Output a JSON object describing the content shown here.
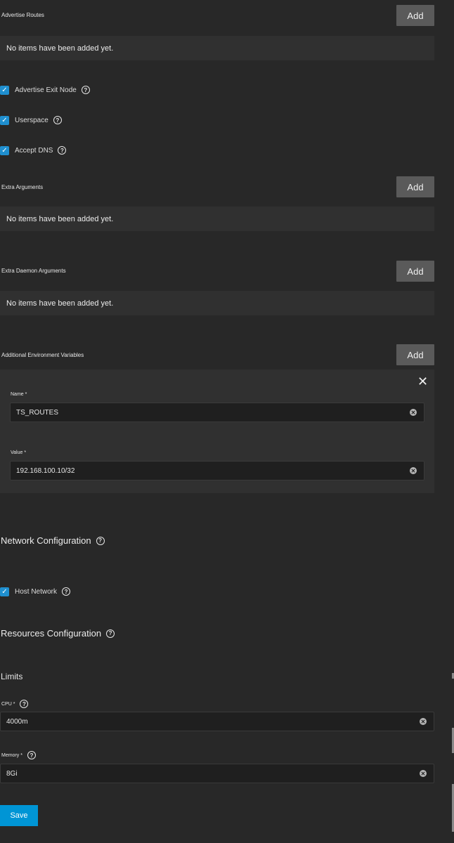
{
  "advertise_routes": {
    "label": "Advertise Routes",
    "add_label": "Add",
    "empty_text": "No items have been added yet."
  },
  "checkboxes": [
    {
      "label": "Advertise Exit Node",
      "checked": true
    },
    {
      "label": "Userspace",
      "checked": true
    },
    {
      "label": "Accept DNS",
      "checked": true
    }
  ],
  "extra_arguments": {
    "label": "Extra Arguments",
    "add_label": "Add",
    "empty_text": "No items have been added yet."
  },
  "extra_daemon_arguments": {
    "label": "Extra Daemon Arguments",
    "add_label": "Add",
    "empty_text": "No items have been added yet."
  },
  "env_vars": {
    "label": "Additional Environment Variables",
    "add_label": "Add",
    "items": [
      {
        "name_label": "Name *",
        "name_value": "TS_ROUTES",
        "value_label": "Value *",
        "value_value": "192.168.100.10/32"
      }
    ]
  },
  "network": {
    "title": "Network Configuration",
    "host_network_label": "Host Network",
    "host_network_checked": true
  },
  "resources": {
    "title": "Resources Configuration",
    "limits_label": "Limits",
    "cpu_label": "CPU *",
    "cpu_value": "4000m",
    "memory_label": "Memory *",
    "memory_value": "8Gi"
  },
  "save_label": "Save",
  "colors": {
    "accent": "#0095d5",
    "checkbox": "#1f8fcf",
    "background": "#282828"
  }
}
